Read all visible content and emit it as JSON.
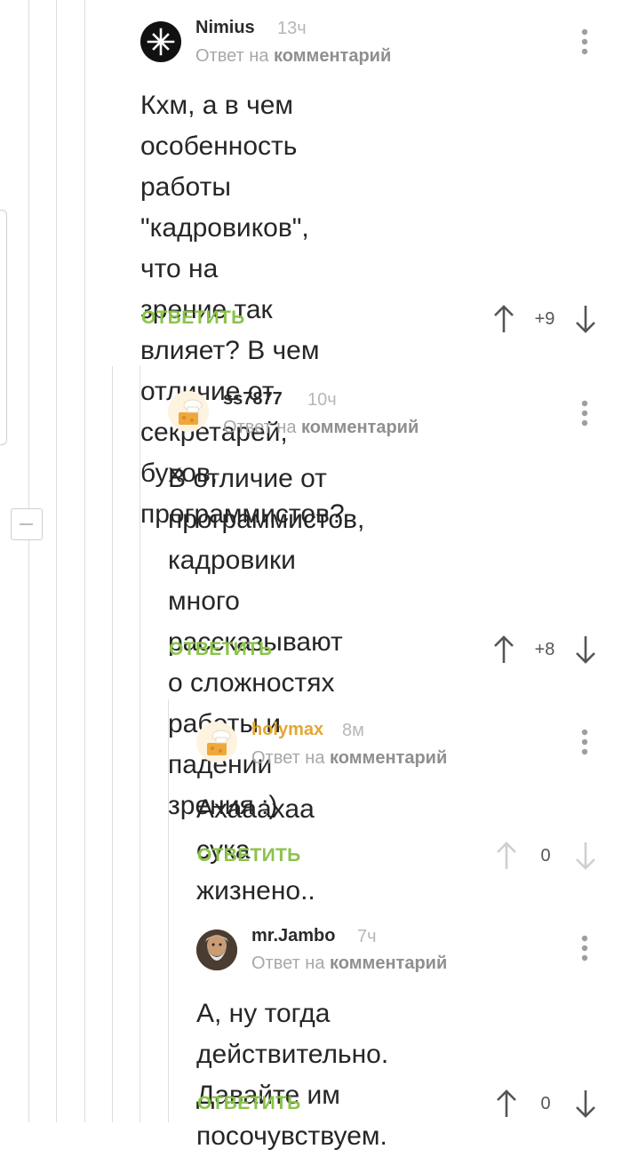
{
  "comments": [
    {
      "user": "Nimius",
      "time": "13ч",
      "reply_prefix": "Ответ на",
      "reply_target": "комментарий",
      "body": [
        "Кхм, а в чем особенность",
        "работы \"кадровиков\", что на",
        "зрение так влияет? В чем",
        "отличие от секретарей, бухов,",
        "программистов?"
      ],
      "reply_label": "ОТВЕТИТЬ",
      "votes": "+9",
      "avatar_icon": "metallica-star-icon"
    },
    {
      "user": "ss7877",
      "time": "10ч",
      "reply_prefix": "Ответ на",
      "reply_target": "комментарий",
      "body": [
        "В отличие от программистов,",
        "кадровики много рассказывают",
        "о сложностях работы и падении",
        "зрения :)"
      ],
      "reply_label": "ОТВЕТИТЬ",
      "votes": "+8",
      "avatar_icon": "chef-hat-cheese-icon"
    },
    {
      "user": "holymax",
      "time": "8м",
      "reply_prefix": "Ответ на",
      "reply_target": "комментарий",
      "body": [
        "Ахааахаа сука жизнено.."
      ],
      "reply_label": "ОТВЕТИТЬ",
      "votes": "0",
      "avatar_icon": "chef-hat-cheese-icon"
    },
    {
      "user": "mr.Jambo",
      "time": "7ч",
      "reply_prefix": "Ответ на",
      "reply_target": "комментарий",
      "body": [
        "А, ну тогда действительно.",
        "Давайте им посочувствуем."
      ],
      "reply_label": "ОТВЕТИТЬ",
      "votes": "0",
      "avatar_icon": "bearded-man-icon"
    }
  ],
  "colors": {
    "accent_green": "#8bc34a",
    "own_username": "#e2a733",
    "thread_line": "#dedede"
  }
}
